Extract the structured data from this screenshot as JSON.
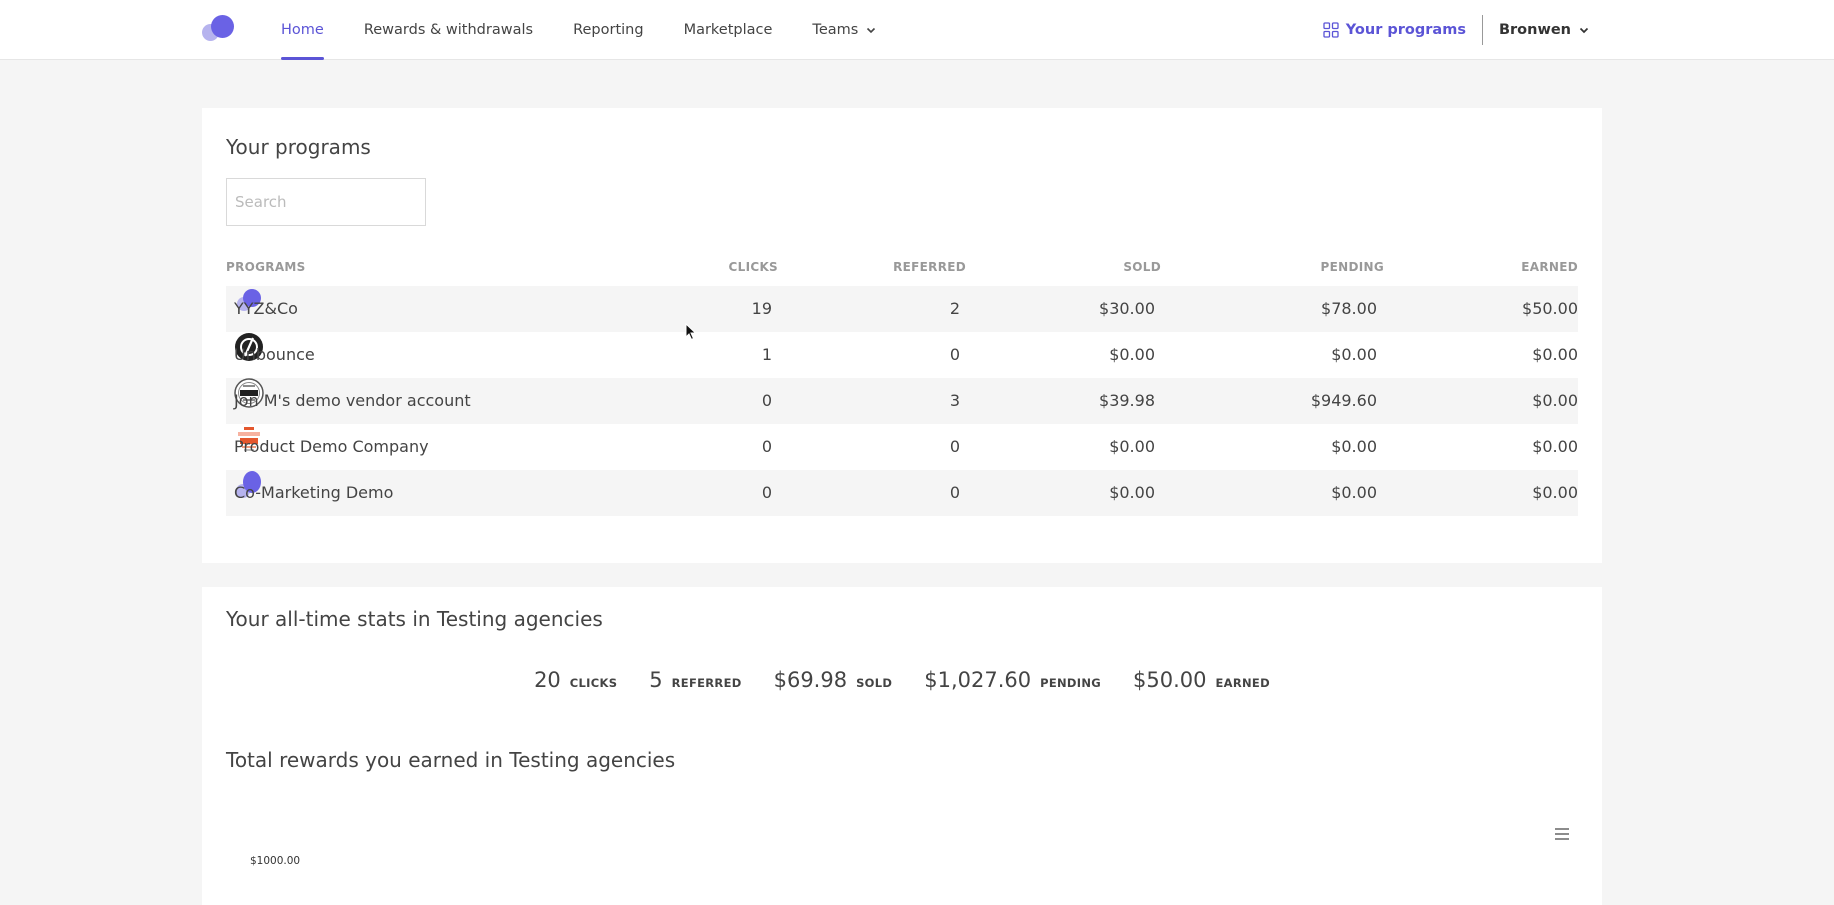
{
  "nav": {
    "items": [
      {
        "label": "Home",
        "active": true
      },
      {
        "label": "Rewards & withdrawals",
        "active": false
      },
      {
        "label": "Reporting",
        "active": false
      },
      {
        "label": "Marketplace",
        "active": false
      },
      {
        "label": "Teams",
        "active": false,
        "dropdown": true
      }
    ],
    "your_programs": "Your programs",
    "user": "Bronwen"
  },
  "programs": {
    "title": "Your programs",
    "search_placeholder": "Search",
    "columns": {
      "program": "PROGRAMS",
      "clicks": "CLICKS",
      "referred": "REFERRED",
      "sold": "SOLD",
      "pending": "PENDING",
      "earned": "EARNED"
    },
    "rows": [
      {
        "name": "YYZ&Co",
        "icon": "yyz-logo-icon",
        "clicks": "19",
        "referred": "2",
        "sold": "$30.00",
        "pending": "$78.00",
        "earned": "$50.00"
      },
      {
        "name": "Unbounce",
        "icon": "unbounce-logo-icon",
        "clicks": "1",
        "referred": "0",
        "sold": "$0.00",
        "pending": "$0.00",
        "earned": "$0.00"
      },
      {
        "name": "Jon M's demo vendor account",
        "icon": "logo-badge-icon",
        "clicks": "0",
        "referred": "3",
        "sold": "$39.98",
        "pending": "$949.60",
        "earned": "$0.00"
      },
      {
        "name": "Product Demo Company",
        "icon": "product-demo-logo-icon",
        "clicks": "0",
        "referred": "0",
        "sold": "$0.00",
        "pending": "$0.00",
        "earned": "$0.00"
      },
      {
        "name": "Co-Marketing Demo",
        "icon": "co-marketing-logo-icon",
        "clicks": "0",
        "referred": "0",
        "sold": "$0.00",
        "pending": "$0.00",
        "earned": "$0.00"
      }
    ]
  },
  "stats": {
    "title": "Your all-time stats in Testing agencies",
    "items": [
      {
        "value": "20",
        "label": "CLICKS"
      },
      {
        "value": "5",
        "label": "REFERRED"
      },
      {
        "value": "$69.98",
        "label": "SOLD"
      },
      {
        "value": "$1,027.60",
        "label": "PENDING"
      },
      {
        "value": "$50.00",
        "label": "EARNED"
      }
    ]
  },
  "rewards": {
    "title": "Total rewards you earned in Testing agencies",
    "y_tick": "$1000.00"
  },
  "colors": {
    "accent": "#5b54d6",
    "logo_dark": "#6a62e5",
    "logo_light": "#b6b3ee"
  }
}
